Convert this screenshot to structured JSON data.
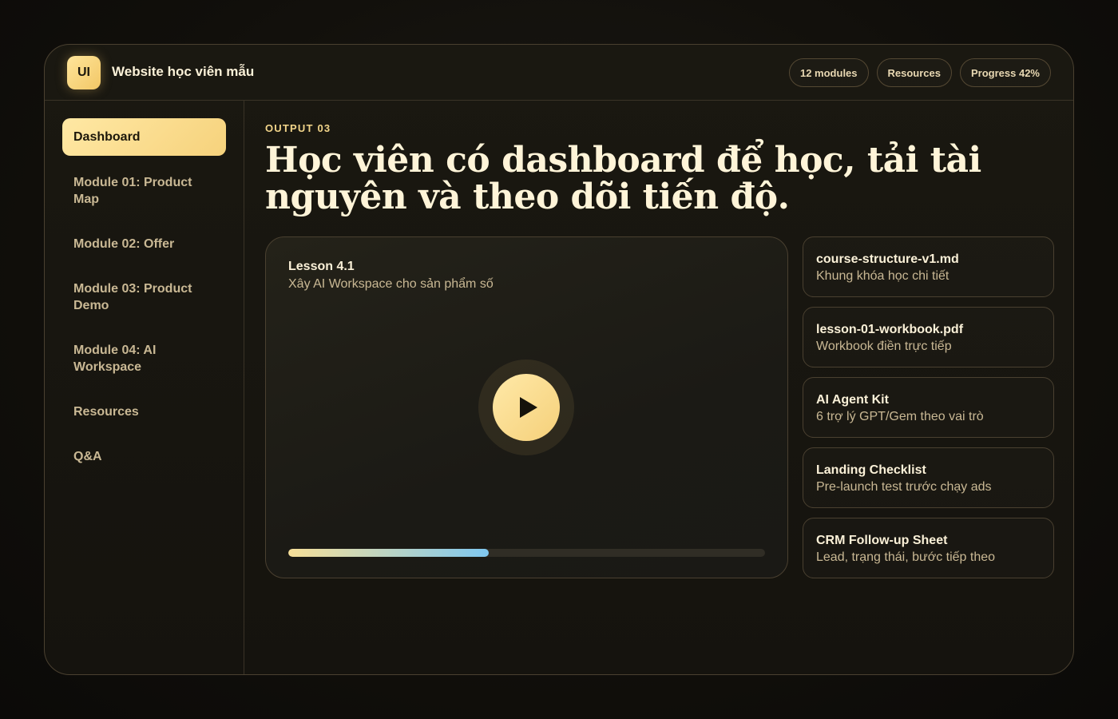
{
  "header": {
    "logo_text": "UI",
    "title": "Website học viên mẫu",
    "pills": [
      "12 modules",
      "Resources",
      "Progress 42%"
    ]
  },
  "sidebar": {
    "items": [
      {
        "label": "Dashboard",
        "active": true
      },
      {
        "label": "Module 01: Product Map",
        "active": false
      },
      {
        "label": "Module 02: Offer",
        "active": false
      },
      {
        "label": "Module 03: Product Demo",
        "active": false
      },
      {
        "label": "Module 04: AI Workspace",
        "active": false
      },
      {
        "label": "Resources",
        "active": false
      },
      {
        "label": "Q&A",
        "active": false
      }
    ]
  },
  "main": {
    "eyebrow": "OUTPUT 03",
    "headline": "Học viên có dashboard để học, tải tài nguyên và theo dõi tiến độ.",
    "player": {
      "lesson_title": "Lesson 4.1",
      "lesson_subtitle": "Xây AI Workspace cho sản phẩm số",
      "progress": 0.42
    },
    "resources": [
      {
        "name": "course-structure-v1.md",
        "desc": "Khung khóa học chi tiết"
      },
      {
        "name": "lesson-01-workbook.pdf",
        "desc": "Workbook điền trực tiếp"
      },
      {
        "name": "AI Agent Kit",
        "desc": "6 trợ lý GPT/Gem theo vai trò"
      },
      {
        "name": "Landing Checklist",
        "desc": "Pre-launch test trước chạy ads"
      },
      {
        "name": "CRM Follow-up Sheet",
        "desc": "Lead, trạng thái, bước tiếp theo"
      }
    ]
  },
  "colors": {
    "accent": "#f6d27c",
    "background": "#15130e",
    "progress_start": "#f7df98",
    "progress_end": "#7fc8f0"
  },
  "icons": {
    "play": "play-icon"
  }
}
